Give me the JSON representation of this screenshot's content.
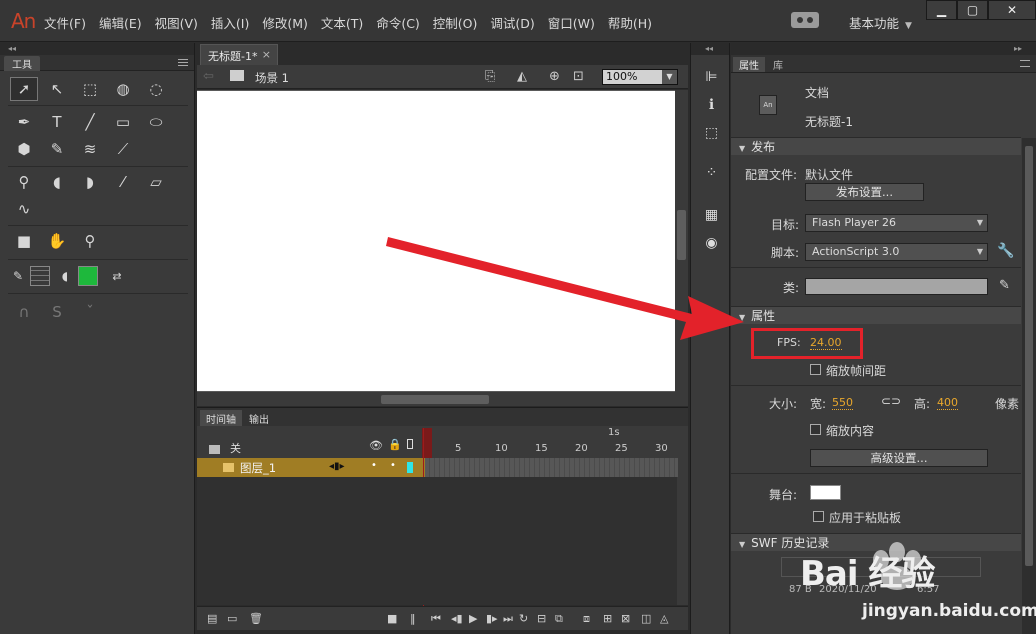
{
  "app": {
    "logo": "An",
    "menu": [
      "文件(F)",
      "编辑(E)",
      "视图(V)",
      "插入(I)",
      "修改(M)",
      "文本(T)",
      "命令(C)",
      "控制(O)",
      "调试(D)",
      "窗口(W)",
      "帮助(H)"
    ],
    "workspace": "基本功能",
    "window_buttons": [
      "▁",
      "▢",
      "✕"
    ]
  },
  "tools_panel": {
    "collapse": "◂◂",
    "tab": "工具"
  },
  "document": {
    "tab_label": "无标题-1*",
    "tab_close": "×",
    "scene_label": "场景 1",
    "zoom": "100%"
  },
  "timeline": {
    "tabs": [
      "时间轴",
      "输出"
    ],
    "header_layer_label": "关",
    "one_second": "1s",
    "frame_numbers": [
      "1",
      "5",
      "10",
      "15",
      "20",
      "25",
      "30"
    ],
    "layer_name": "图层_1"
  },
  "properties": {
    "tabs": [
      "属性",
      "库"
    ],
    "doc_icon": "An",
    "doc_type": "文档",
    "doc_name": "无标题-1",
    "publish_section": "发布",
    "profile_label": "配置文件:",
    "profile_value": "默认文件",
    "publish_settings_button": "发布设置...",
    "target_label": "目标:",
    "target_value": "Flash Player 26",
    "script_label": "脚本:",
    "script_value": "ActionScript 3.0",
    "class_label": "类:",
    "props_section": "属性",
    "fps_label": "FPS:",
    "fps_value": "24.00",
    "scale_spans": "缩放帧间距",
    "size_label": "大小:",
    "width_label": "宽:",
    "width_value": "550",
    "height_label": "高:",
    "height_value": "400",
    "units": "像素",
    "scale_content": "缩放内容",
    "advanced_button": "高级设置...",
    "stage_label": "舞台:",
    "stage_color": "#ffffff",
    "apply_clipboard": "应用于粘贴板",
    "swf_section": "SWF 历史记录",
    "swf_size": "87 B",
    "swf_date": "2020/11/20",
    "swf_time": "6:57"
  },
  "watermark": {
    "brand": "Bai 经验",
    "url": "jingyan.baidu.com"
  },
  "colors": {
    "accent_red": "#e3222a",
    "fill_color": "#1eb83c",
    "layer_highlight": "#a07d24",
    "hot_text": "#e8a72c"
  }
}
